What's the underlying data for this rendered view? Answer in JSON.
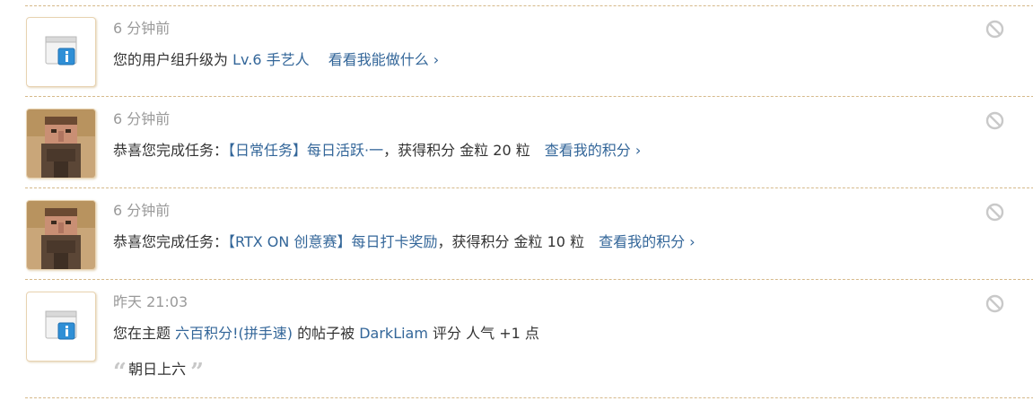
{
  "notices": [
    {
      "time": "6 分钟前",
      "text1": "您的用户组升级为",
      "link1": "Lv.6 手艺人",
      "action": "看看我能做什么 ›",
      "avatar": "system-info-icon"
    },
    {
      "time": "6 分钟前",
      "text1": "恭喜您完成任务：",
      "link1": "【日常任务】每日活跃·一",
      "text2": "，获得积分 金粒 20 粒",
      "action": "查看我的积分 ›",
      "avatar": "villager-avatar"
    },
    {
      "time": "6 分钟前",
      "text1": "恭喜您完成任务：",
      "link1": "【RTX ON 创意赛】每日打卡奖励",
      "text2": "，获得积分 金粒 10 粒",
      "action": "查看我的积分 ›",
      "avatar": "villager-avatar"
    },
    {
      "time": "昨天 21:03",
      "text1": "您在主题",
      "link1": "六百积分!(拼手速)",
      "text2": "的帖子被",
      "link2": "DarkLiam",
      "text3": "评分 人气 +1 点",
      "quote": "朝日上六",
      "avatar": "system-info-icon"
    }
  ],
  "colors": {
    "link": "#336699",
    "time": "#9a9a9a",
    "separator": "#d6b98a"
  }
}
